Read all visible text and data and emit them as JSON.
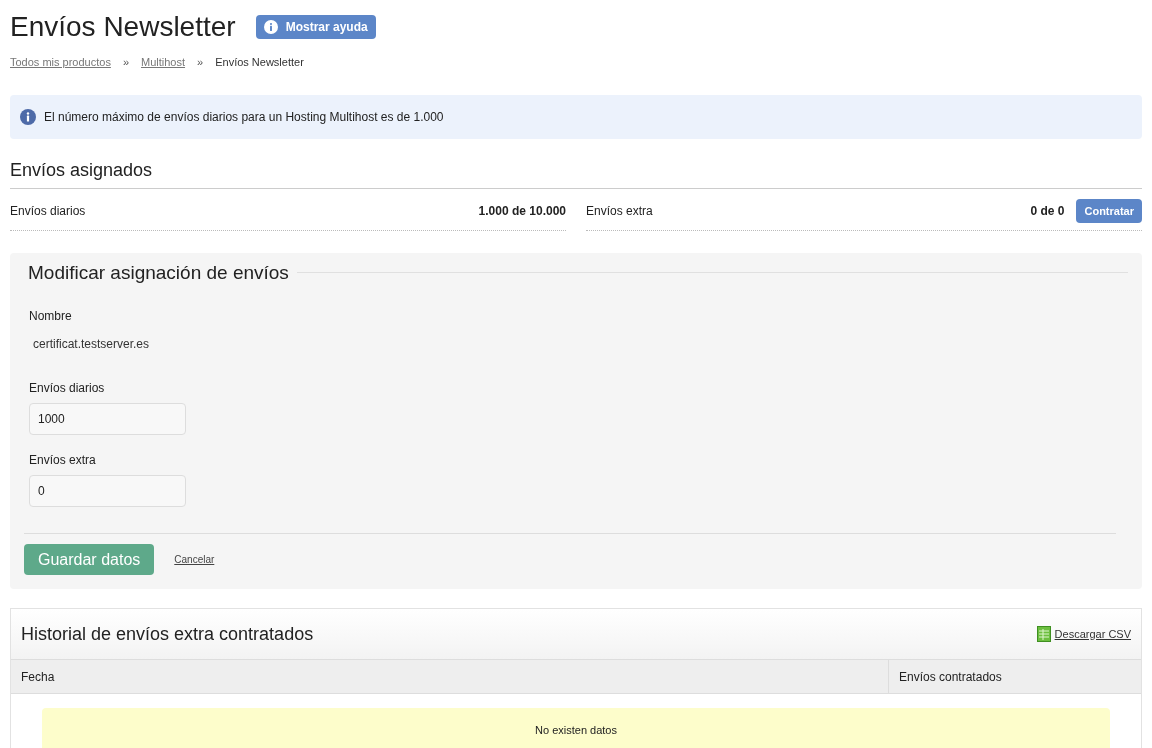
{
  "page": {
    "title": "Envíos Newsletter",
    "help_button": "Mostrar ayuda"
  },
  "breadcrumb": [
    {
      "label": "Todos mis productos",
      "kind": "link"
    },
    {
      "label": "»",
      "kind": "separator"
    },
    {
      "label": "Multihost",
      "kind": "link"
    },
    {
      "label": "»",
      "kind": "separator"
    },
    {
      "label": "Envíos Newsletter",
      "kind": "current"
    }
  ],
  "info": "El número máximo de envíos diarios para un Hosting Multihost es de 1.000",
  "assigned": {
    "title": "Envíos asignados",
    "items": [
      {
        "label": "Envíos diarios",
        "value": "1.000 de 10.000"
      },
      {
        "label": "Envíos extra",
        "value": "0 de 0",
        "button": "Contratar"
      }
    ]
  },
  "form": {
    "title": "Modificar asignación de envíos",
    "name_label": "Nombre",
    "name_value": "certificat.testserver.es",
    "fields": [
      {
        "label": "Envíos diarios",
        "value": "1000"
      },
      {
        "label": "Envíos extra",
        "value": "0"
      }
    ],
    "save": "Guardar datos",
    "cancel": "Cancelar"
  },
  "history": {
    "title": "Historial de envíos extra contratados",
    "download": "Descargar CSV",
    "columns": [
      "Fecha",
      "Envíos contratados"
    ],
    "empty": "No existen datos"
  }
}
